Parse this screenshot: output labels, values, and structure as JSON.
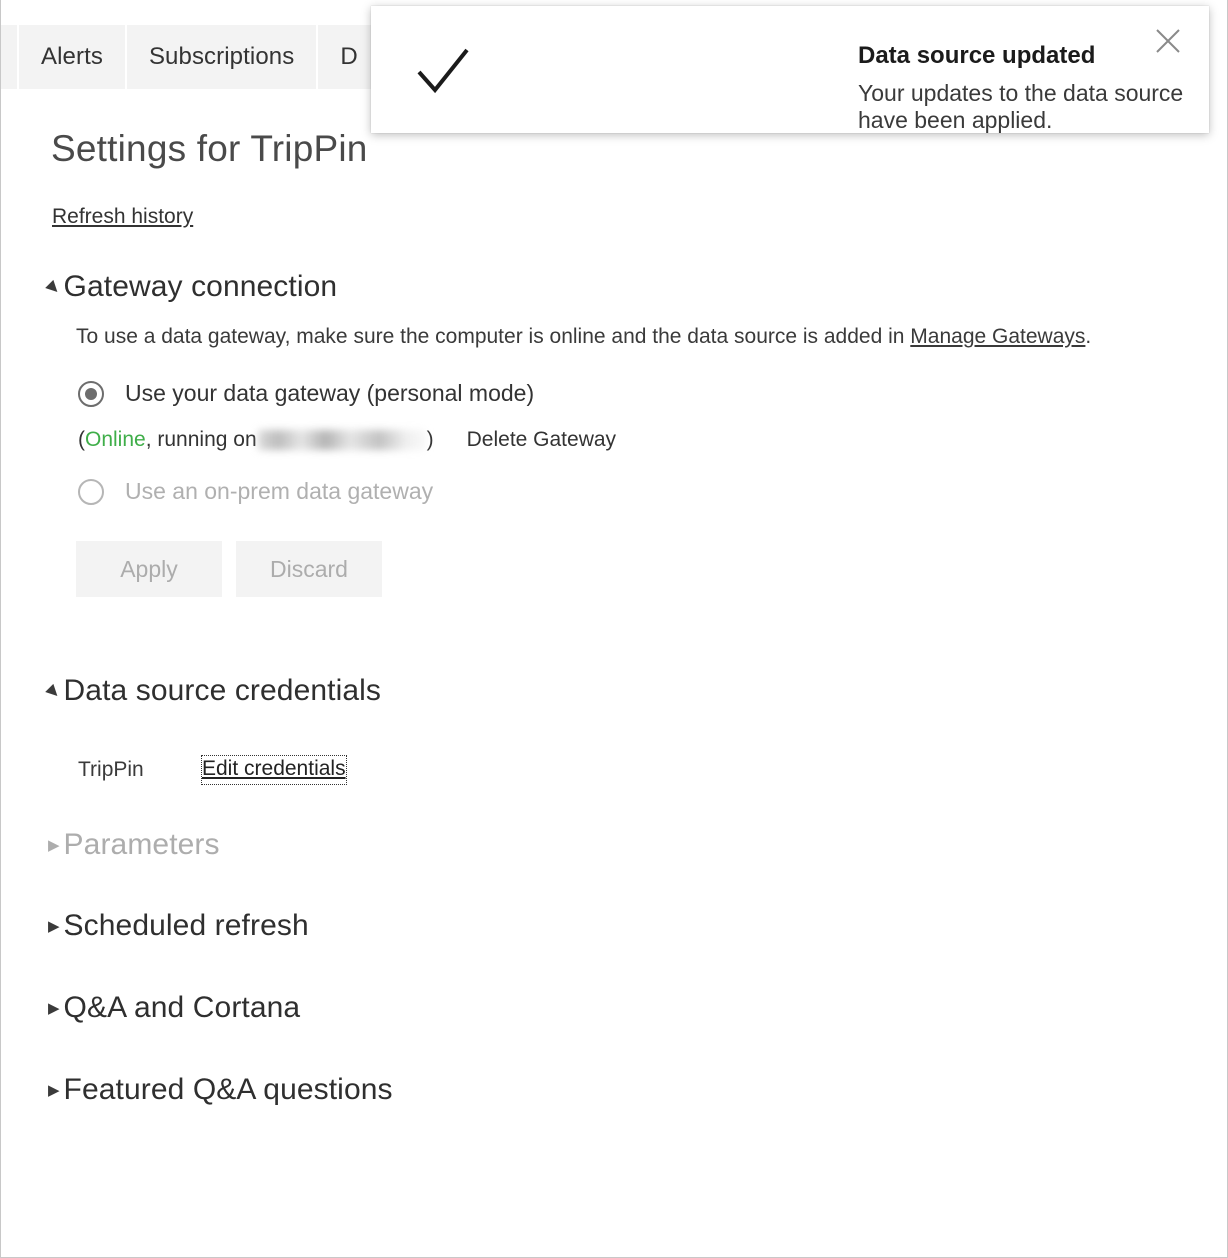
{
  "tabs": [
    {
      "label": "Alerts",
      "clipped": false
    },
    {
      "label": "Subscriptions",
      "clipped": false
    },
    {
      "label": "D",
      "clipped": true
    }
  ],
  "page": {
    "title": "Settings for TripPin",
    "refresh_history_link": "Refresh history"
  },
  "gateway_section": {
    "heading": "Gateway connection",
    "expanded": true,
    "description_before": "To use a data gateway, make sure the computer is online and the data source is added in ",
    "description_link": "Manage Gateways",
    "description_after": ".",
    "personal_option": "Use your data gateway (personal mode)",
    "personal_selected": true,
    "status_open_paren": "(",
    "status_online": "Online",
    "status_running": ", running on ",
    "status_host_redacted": "",
    "status_close_paren": ")",
    "delete_gateway_link": "Delete Gateway",
    "onprem_option": "Use an on-prem data gateway",
    "onprem_selected": false,
    "apply_button": "Apply",
    "discard_button": "Discard",
    "buttons_disabled": true
  },
  "credentials_section": {
    "heading": "Data source credentials",
    "expanded": true,
    "rows": [
      {
        "name": "TripPin",
        "action": "Edit credentials"
      }
    ]
  },
  "collapsed_sections": [
    {
      "heading": "Parameters",
      "disabled": true
    },
    {
      "heading": "Scheduled refresh",
      "disabled": false
    },
    {
      "heading": "Q&A and Cortana",
      "disabled": false
    },
    {
      "heading": "Featured Q&A questions",
      "disabled": false
    }
  ],
  "toast": {
    "title": "Data source updated",
    "message": "Your updates to the data source have been applied.",
    "icon": "check-icon",
    "close_icon": "close-icon"
  },
  "colors": {
    "online_green": "#3fae49",
    "tab_background": "#f3f3f3",
    "text": "#333333"
  }
}
